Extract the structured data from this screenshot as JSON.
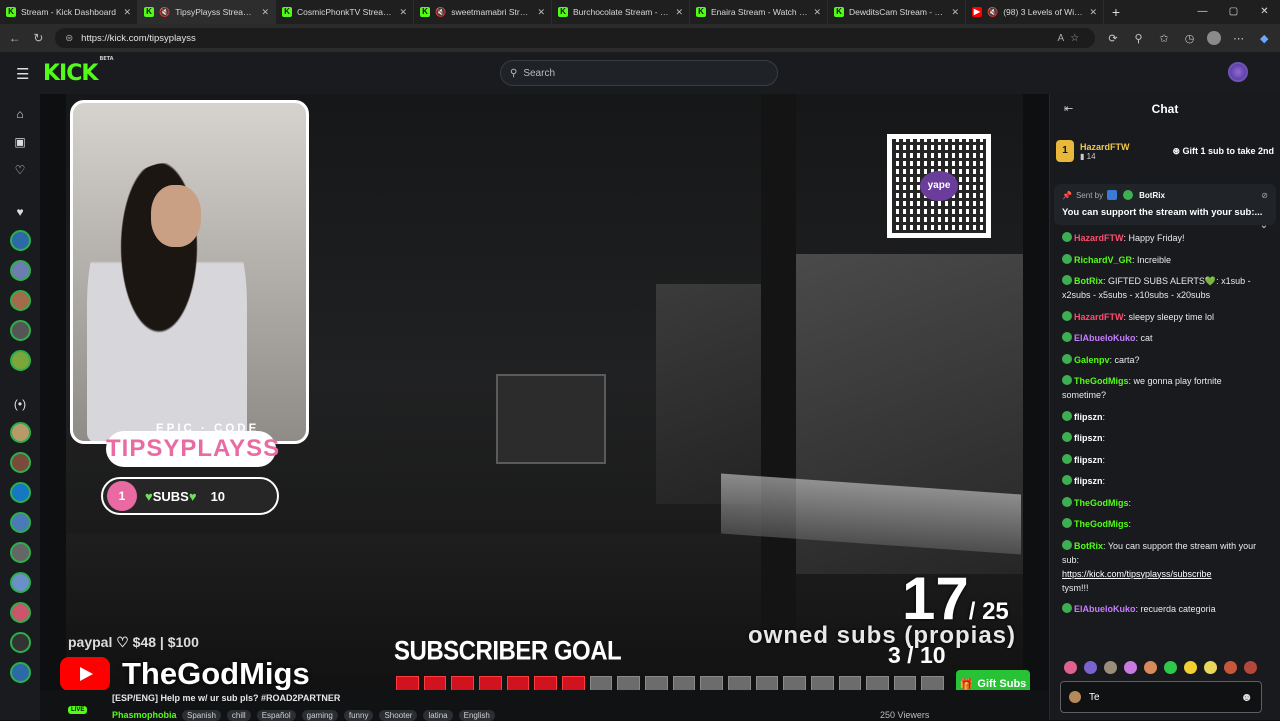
{
  "browser": {
    "tabs": [
      {
        "title": "Stream - Kick Dashboard",
        "icon": "kick-icon",
        "muted": false
      },
      {
        "title": "TipsyPlayss Stream - W",
        "icon": "kick-icon",
        "muted": true
      },
      {
        "title": "CosmicPhonkTV Stream - W",
        "icon": "kick-icon",
        "muted": false
      },
      {
        "title": "sweetmamabri Stream",
        "icon": "kick-icon",
        "muted": true
      },
      {
        "title": "Burchocolate Stream - Wat",
        "icon": "kick-icon",
        "muted": false
      },
      {
        "title": "Enaira Stream - Watch Live",
        "icon": "kick-icon",
        "muted": false
      },
      {
        "title": "DewditsCam Stream - Wat",
        "icon": "kick-icon",
        "muted": false
      },
      {
        "title": "(98) 3 Levels of WiFi H",
        "icon": "youtube-icon",
        "muted": true
      }
    ],
    "url": "https://kick.com/tipsyplayss"
  },
  "kick": {
    "logo": "KICK",
    "logo_sup": "BETA",
    "search_placeholder": "Search"
  },
  "overlay": {
    "epic_code": "EPIC · CODE",
    "brand": "TIPSYPLAYSS",
    "subs_current": "1",
    "subs_label": "SUBS",
    "subs_target": "10",
    "qr_tag": "yape",
    "paypal": "paypal ♡ $48 | $100",
    "owned_count": "17",
    "owned_total": "/ 25",
    "owned_label": "owned subs (propias)",
    "goal_title": "SUBSCRIBER GOAL",
    "goal_count": "3 / 10",
    "goal_progress": 0.3,
    "yt_name": "TheGodMigs",
    "gift_subs": "Gift Subs"
  },
  "stream": {
    "live": "LIVE",
    "title": "[ESP/ENG] Help me w/ ur sub pls? #ROAD2PARTNER",
    "category": "Phasmophobia",
    "tags": [
      "Spanish",
      "chill",
      "Español",
      "gaming",
      "funny",
      "Shooter",
      "latina",
      "English"
    ],
    "viewers": "250 Viewers"
  },
  "chat": {
    "title": "Chat",
    "leader": {
      "rank": "1",
      "name": "HazardFTW",
      "count": "14",
      "gift_text": "Gift 1 sub to take 2nd"
    },
    "pinned": {
      "sent_by": "Sent by",
      "user": "BotRix",
      "text": "You can support the stream with your sub:..."
    },
    "messages": [
      {
        "user": "HazardFTW",
        "color": "#ff4d6d",
        "text": "Happy Friday!"
      },
      {
        "user": "RichardV_GR",
        "color": "#53fc18",
        "text": "Increible"
      },
      {
        "user": "BotRix",
        "color": "#53fc18",
        "text": "GIFTED SUBS ALERTS💚: x1sub - x2subs - x5subs - x10subs - x20subs"
      },
      {
        "user": "HazardFTW",
        "color": "#ff4d6d",
        "text": "sleepy sleepy time lol"
      },
      {
        "user": "ElAbueloKuko",
        "color": "#c77dff",
        "text": "cat"
      },
      {
        "user": "Galenpv",
        "color": "#53fc18",
        "text": "carta?"
      },
      {
        "user": "TheGodMigs",
        "color": "#53fc18",
        "text": "we gonna play fortnite sometime?"
      },
      {
        "user": "flipszn",
        "color": "#ffffff",
        "text": ""
      },
      {
        "user": "flipszn",
        "color": "#ffffff",
        "text": ""
      },
      {
        "user": "flipszn",
        "color": "#ffffff",
        "text": ""
      },
      {
        "user": "flipszn",
        "color": "#ffffff",
        "text": ""
      },
      {
        "user": "TheGodMigs",
        "color": "#53fc18",
        "text": ""
      },
      {
        "user": "TheGodMigs",
        "color": "#53fc18",
        "text": ""
      },
      {
        "user": "BotRix",
        "color": "#53fc18",
        "text": "You can support the stream with your sub:",
        "link": "https://kick.com/tipsyplayss/subscribe",
        "after": "tysm!!!"
      },
      {
        "user": "ElAbueloKuko",
        "color": "#c77dff",
        "text": "recuerda categoria"
      }
    ],
    "input_value": "Te"
  },
  "colors": {
    "brand": "#53fc18",
    "accent_pink": "#ea6ba4",
    "goal_red": "#d0131e"
  }
}
